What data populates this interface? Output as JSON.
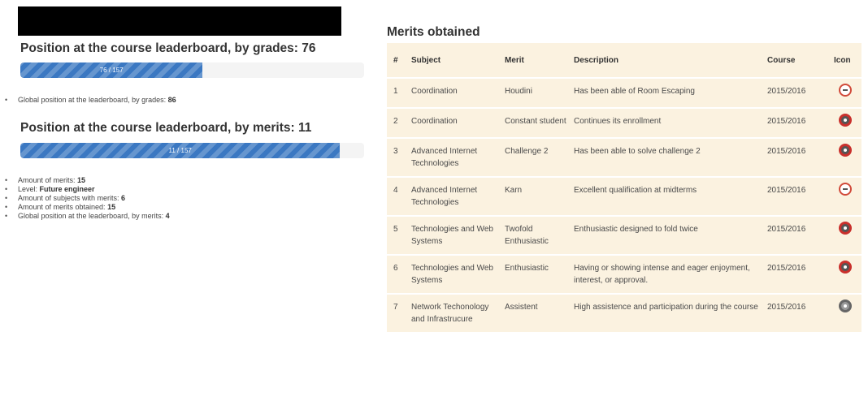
{
  "leaderboard": {
    "grades_title": "Position at the course leaderboard, by grades: 76",
    "grades_progress_label": "76 / 157",
    "grades_progress_fraction": 0.53,
    "grades_stats": [
      {
        "label": "Global position at the leaderboard, by grades: ",
        "value": "86"
      }
    ],
    "merits_title": "Position at the course leaderboard, by merits: 11",
    "merits_progress_label": "11 / 157",
    "merits_progress_fraction": 0.93,
    "merits_stats": [
      {
        "label": "Amount of merits: ",
        "value": "15"
      },
      {
        "label": "Level: ",
        "value": "Future engineer"
      },
      {
        "label": "Amount of subjects with merits: ",
        "value": "6"
      },
      {
        "label": "Amount of merits obtained: ",
        "value": "15"
      },
      {
        "label": "Global position at the leaderboard, by merits: ",
        "value": "4"
      }
    ]
  },
  "merits": {
    "title": "Merits obtained",
    "columns": [
      "#",
      "Subject",
      "Merit",
      "Description",
      "Course",
      "Icon"
    ],
    "rows": [
      {
        "num": "1",
        "subject": "Coordination",
        "merit": "Houdini",
        "description": "Has been able of Room Escaping",
        "course": "2015/2016",
        "icon": "face-badge-icon"
      },
      {
        "num": "2",
        "subject": "Coordination",
        "merit": "Constant student",
        "description": "Continues its enrollment",
        "course": "2015/2016",
        "icon": "ring-badge-icon"
      },
      {
        "num": "3",
        "subject": "Advanced Internet Technologies",
        "merit": "Challenge 2",
        "description": "Has been able to solve challenge 2",
        "course": "2015/2016",
        "icon": "ring-badge-icon"
      },
      {
        "num": "4",
        "subject": "Advanced Internet Technologies",
        "merit": "Karn",
        "description": "Excellent qualification at midterms",
        "course": "2015/2016",
        "icon": "face-badge-icon"
      },
      {
        "num": "5",
        "subject": "Technologies and Web Systems",
        "merit": "Twofold Enthusiastic",
        "description": "Enthusiastic designed to fold twice",
        "course": "2015/2016",
        "icon": "ring-badge-icon"
      },
      {
        "num": "6",
        "subject": "Technologies and Web Systems",
        "merit": "Enthusiastic",
        "description": "Having or showing intense and eager enjoyment, interest, or approval.",
        "course": "2015/2016",
        "icon": "ring-badge-icon"
      },
      {
        "num": "7",
        "subject": "Network Techonology and Infrastrucure",
        "merit": "Assistent",
        "description": "High assistence and participation during the course",
        "course": "2015/2016",
        "icon": "gray-badge-icon"
      }
    ]
  },
  "colors": {
    "progress_bar": "#3b78c2",
    "table_background": "#fbf2e0",
    "badge_red": "#c9302c"
  }
}
